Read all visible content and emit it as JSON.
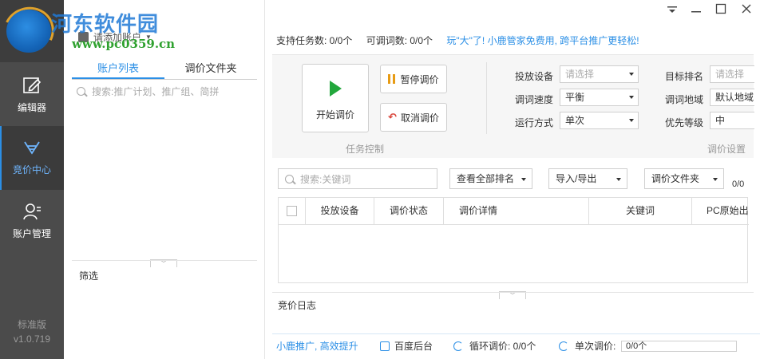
{
  "watermark": {
    "title": "河东软件园",
    "url": "www.pc0359.cn"
  },
  "nav": {
    "items": [
      {
        "label": "编辑器",
        "icon": "edit-icon"
      },
      {
        "label": "竞价中心",
        "icon": "bid-center-icon",
        "active": true
      },
      {
        "label": "账户管理",
        "icon": "account-manage-icon"
      }
    ],
    "edition": "标准版",
    "version": "v1.0.719"
  },
  "account": {
    "add_label": "请添加账户",
    "tabs": [
      "账户列表",
      "调价文件夹"
    ],
    "search_placeholder": "搜索:推广计划、推广组、简拼",
    "filter_label": "筛选"
  },
  "topbar": {
    "task_count": "支持任务数: 0/0个",
    "adjustable_count": "可调词数: 0/0个",
    "promo": "玩\"大\"了! 小鹿管家免费用, 跨平台推广更轻松!"
  },
  "task_control": {
    "start_label": "开始调价",
    "pause_label": "暂停调价",
    "cancel_label": "取消调价",
    "section_label": "任务控制"
  },
  "settings": {
    "section_label": "调价设置",
    "device": {
      "label": "投放设备",
      "value": "请选择"
    },
    "speed": {
      "label": "调词速度",
      "value": "平衡"
    },
    "mode": {
      "label": "运行方式",
      "value": "单次"
    },
    "target_rank": {
      "label": "目标排名",
      "value": "请选择"
    },
    "region": {
      "label": "调词地域",
      "value": "默认地域"
    },
    "priority": {
      "label": "优先等级",
      "value": "中"
    }
  },
  "keyword_toolbar": {
    "search_placeholder": "搜索:关键词",
    "view_all_rank": "查看全部排名",
    "import_export": "导入/导出",
    "price_folder": "调价文件夹",
    "count": "0/0"
  },
  "table": {
    "columns": [
      "投放设备",
      "调价状态",
      "调价详情",
      "关键词",
      "PC原始出"
    ]
  },
  "log": {
    "label": "竞价日志"
  },
  "statusbar": {
    "slogan": "小鹿推广, 高效提升",
    "baidu_backend": "百度后台",
    "cycle": "循环调价: 0/0个",
    "single": "单次调价:",
    "single_progress": "0/0个"
  },
  "colors": {
    "accent": "#2b8fe6",
    "nav_bg": "#4b4b4b",
    "start_green": "#22a73c",
    "pause_orange": "#e79b14",
    "cancel_red": "#d9463c"
  }
}
